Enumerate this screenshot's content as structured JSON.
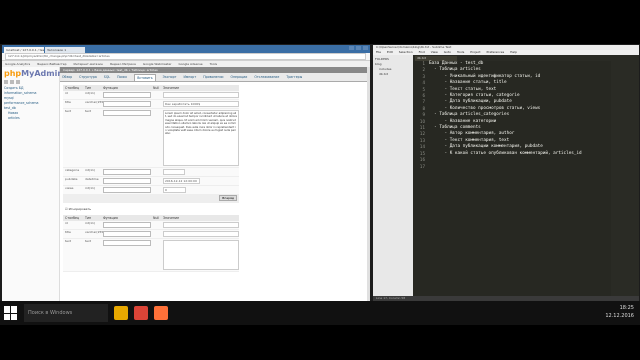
{
  "browser": {
    "tabs": [
      "localhost / 127.0.0.1 / test_db",
      "Заголовок 1"
    ],
    "url": "127.0.0.1/phpmyadmin/tbl_change.php?db=test_db&table=articles",
    "bookmarks": [
      "Google Analytics",
      "Яндекс.Вебмастер",
      "Интернет-магазин",
      "Яндекс.Метрика",
      "Google Webmaster",
      "Google Adsense",
      "Tools"
    ]
  },
  "pma": {
    "logo_a": "php",
    "logo_b": "MyAdmin",
    "tree": [
      "Создать БД",
      "information_schema",
      "mysql",
      "performance_schema",
      "test_db",
      "Новая",
      "articles"
    ],
    "server_bar": "Сервер: 127.0.0.1 » База данных: test_db » Таблица: articles",
    "tabs": [
      "Обзор",
      "Структура",
      "SQL",
      "Поиск",
      "Вставить",
      "Экспорт",
      "Импорт",
      "Привилегии",
      "Операции",
      "Отслеживание",
      "Триггеры"
    ],
    "headers": [
      "Столбец",
      "Тип",
      "Функция",
      "Null",
      "Значение"
    ],
    "rows": [
      {
        "col": "id",
        "type": "int(11)",
        "value": ""
      },
      {
        "col": "title",
        "type": "varchar(255)",
        "value": "Как заработать 1000$"
      },
      {
        "col": "text",
        "type": "text",
        "value": "Lorem ipsum dolor sit amet, consectetur adipisicing elit, sed do eiusmod tempor incididunt ut labore et dolore magna aliqua. Ut enim ad minim veniam, quis nostrud exercitation ullamco laboris nisi ut aliquip ex ea commodo consequat. Duis aute irure dolor in reprehenderit in voluptate velit esse cillum dolore eu fugiat nulla pariatur."
      },
      {
        "col": "categorie",
        "type": "int(11)",
        "value": ""
      },
      {
        "col": "pubdate",
        "type": "datetime",
        "value": "2016-12-12 12:00:00"
      },
      {
        "col": "views",
        "type": "int(11)",
        "value": "0"
      }
    ],
    "go_label": "Вперёд",
    "ignore_label": "Игнорировать",
    "rows2": [
      {
        "col": "id",
        "type": "int(11)"
      },
      {
        "col": "title",
        "type": "varchar(255)"
      },
      {
        "col": "text",
        "type": "text"
      }
    ]
  },
  "sublime": {
    "title": "C:\\OpenServer\\domains\\blog\\db.txt - Sublime Text",
    "menu": [
      "File",
      "Edit",
      "Selection",
      "Find",
      "View",
      "Goto",
      "Tools",
      "Project",
      "Preferences",
      "Help"
    ],
    "sidebar": [
      "FOLDERS",
      "blog",
      "includes",
      "db.txt"
    ],
    "tab": "db.txt",
    "lines": [
      "База Данных - test_db",
      "  - Таблица articles",
      "      - Уникальный идентификатор статьи, id",
      "      - Название статьи, title",
      "      - Текст статьи, text",
      "      - Категория статьи, categorie",
      "      - Дата публикации, pubdate",
      "      - Количество просмотров статьи, views",
      "",
      "  - Таблица articles_categories",
      "      - Название категории",
      "",
      "  - Таблица comments",
      "      - Автор комментария, author",
      "      - Текст комментария, text",
      "      - Дата публикации комментария, pubdate",
      "      - К какой статье опубликован комментарий, articles_id"
    ],
    "status": "Line 17, Column 58"
  },
  "taskbar": {
    "search": "Поиск в Windows",
    "time": "18:25",
    "date": "12.12.2016"
  }
}
